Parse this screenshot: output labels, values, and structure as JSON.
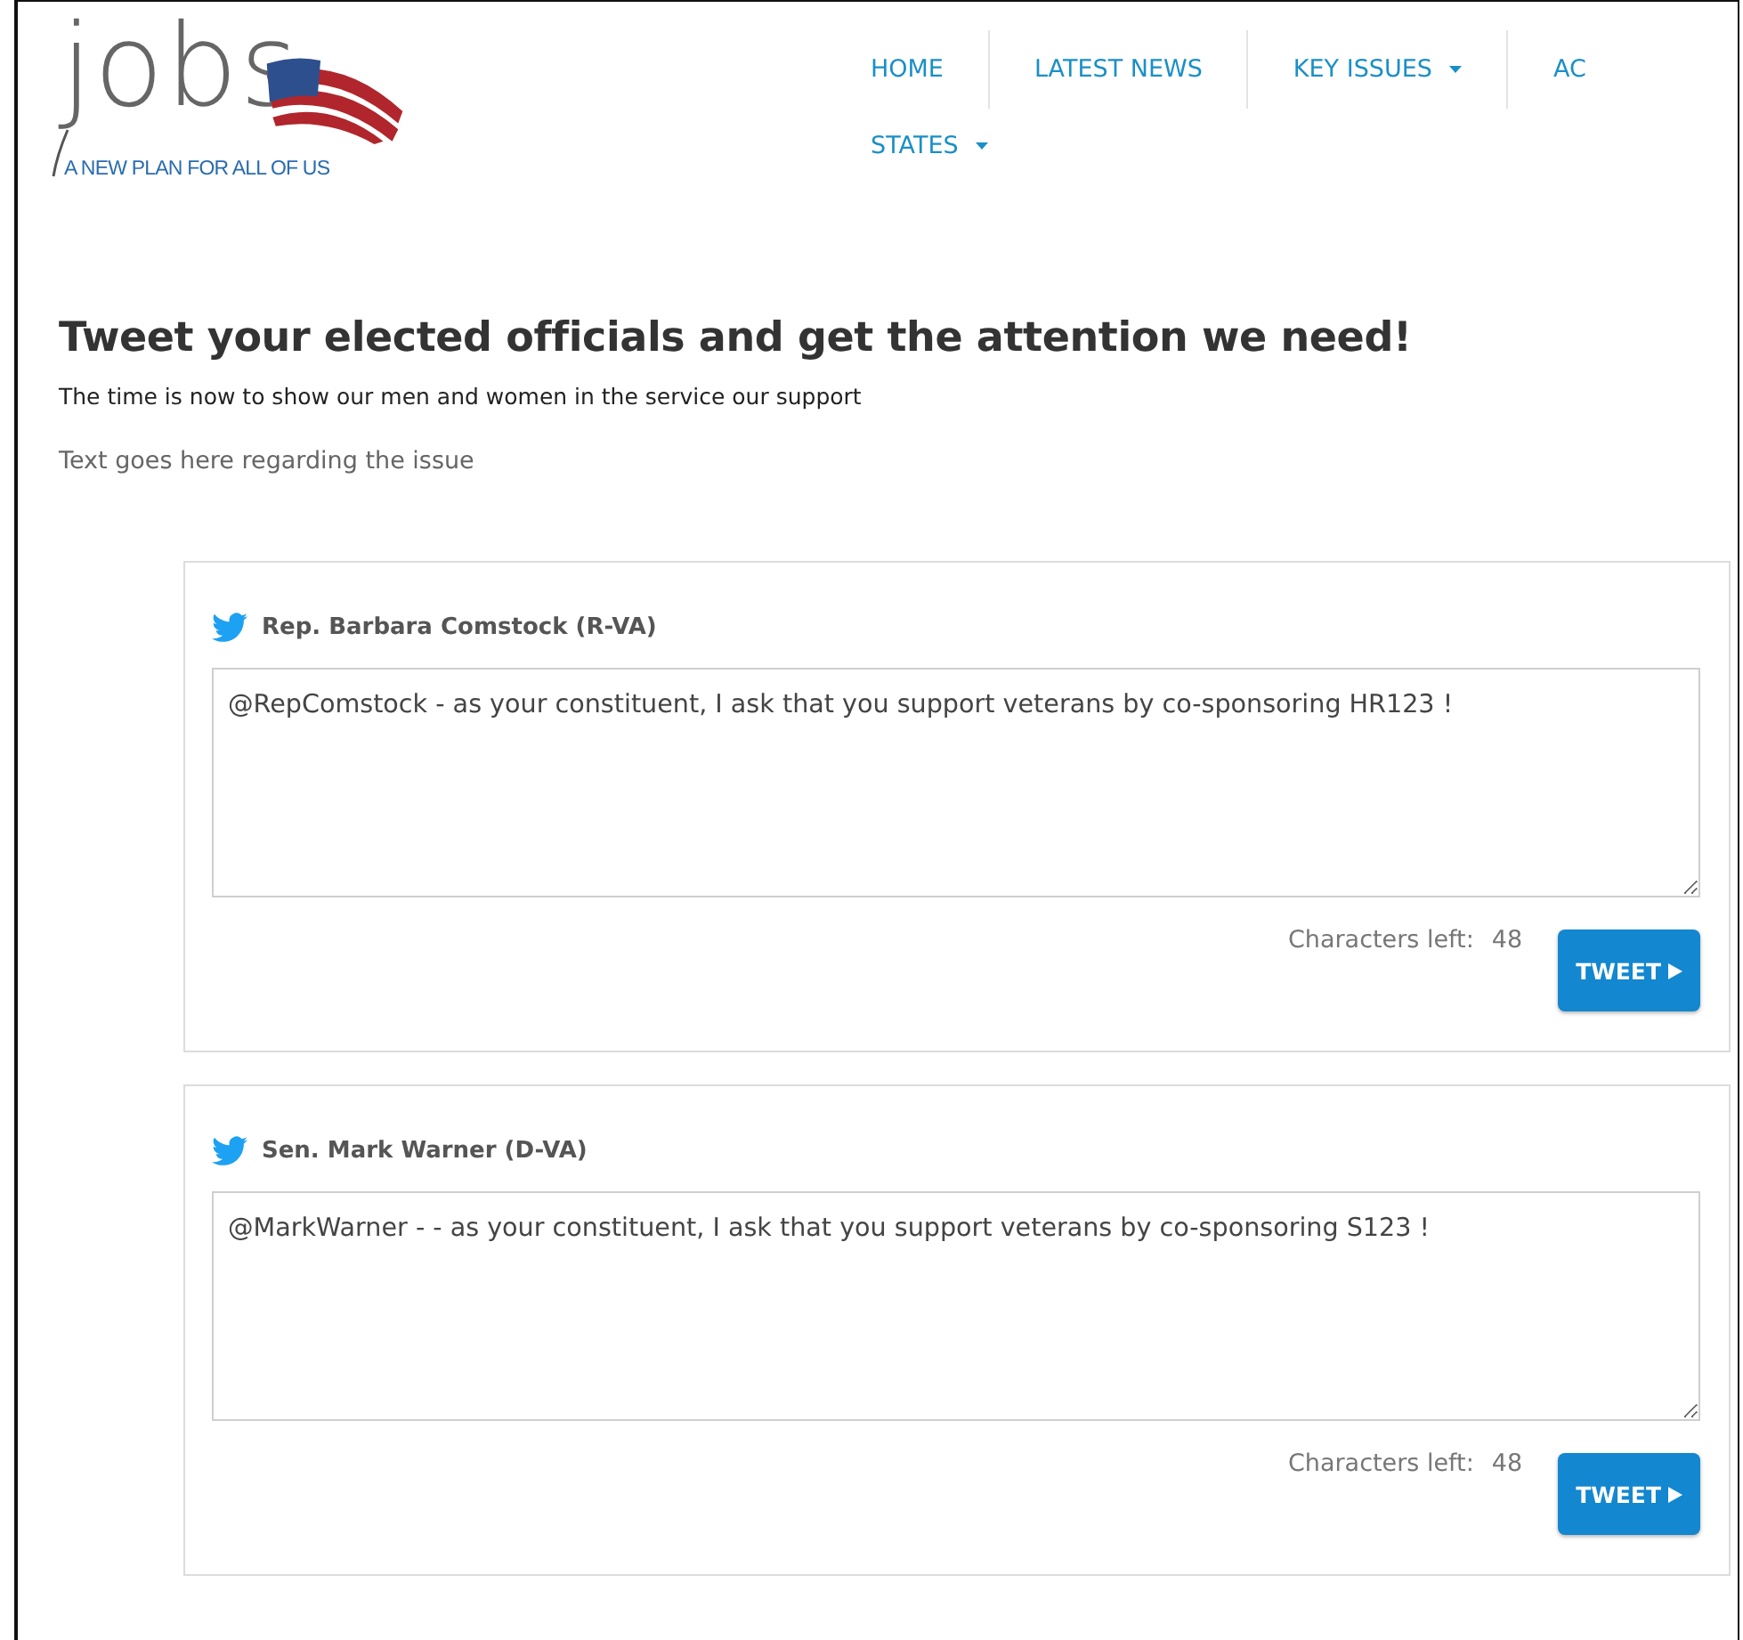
{
  "logo": {
    "wordmark": "jobs",
    "tagline": "A NEW PLAN FOR ALL OF US"
  },
  "nav": [
    {
      "items": [
        {
          "label": "HOME",
          "dropdown": false
        },
        {
          "label": "LATEST NEWS",
          "dropdown": false
        },
        {
          "label": "KEY ISSUES",
          "dropdown": true
        },
        {
          "label": "AC",
          "dropdown": false
        }
      ]
    },
    {
      "items": [
        {
          "label": "STATES",
          "dropdown": true
        }
      ]
    }
  ],
  "heading": "Tweet your elected officials and get the attention we need!",
  "subheading": "The time is now to show our men and women in the service our support",
  "intro": "Text goes here regarding the issue",
  "officials": [
    {
      "name": "Rep. Barbara Comstock (R-VA)",
      "message": "@RepComstock - as your constituent, I ask that you support veterans by co-sponsoring HR123 !",
      "counter_label": "Characters left:",
      "counter": "48",
      "button": "TWEET"
    },
    {
      "name": "Sen. Mark Warner (D-VA)",
      "message": "@MarkWarner - - as your constituent, I ask that you support veterans by co-sponsoring S123 !",
      "counter_label": "Characters left:",
      "counter": "48",
      "button": "TWEET"
    }
  ]
}
